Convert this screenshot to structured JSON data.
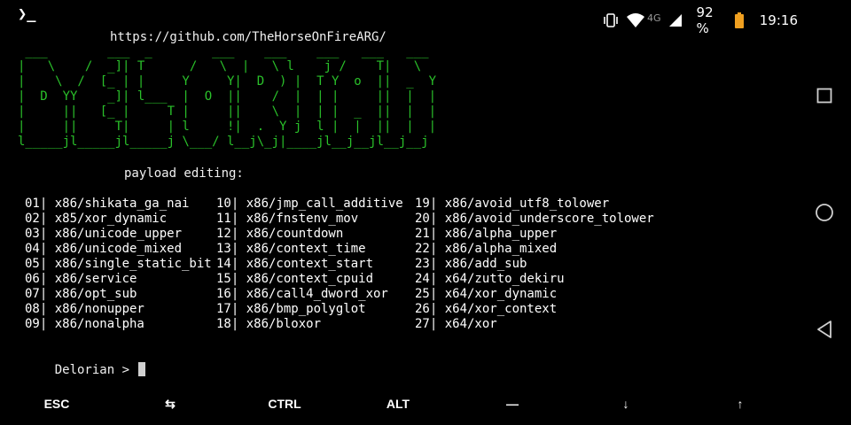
{
  "status": {
    "app_icon": "❯_",
    "network_type": "4G",
    "battery": "92 %",
    "time": "19:16",
    "icons": [
      "vibrate-icon",
      "wifi-icon",
      "signal-icon",
      "battery-icon"
    ],
    "battery_color": "#f0a020"
  },
  "terminal": {
    "url": "https://github.com/TheHorseOnFireARG/",
    "banner": [
      " ___        ___  _        ___    ___    ___   ___   ___",
      "|   \\    /  _]| T      /   \\  |   \\ l    j /    T|   \\",
      "|    \\  /  [_ | |     Y     Y|  D  ) |  T Y  o  ||  _  Y",
      "|  D  YY    _]| l___  |  O  ||    /  |  | |     ||  |  |",
      "|     ||   [_ |     T |     ||    \\  |  | |  _  ||  |  |",
      "|     ||     T|     | l     !|  .  Y j  l |  |  ||  |  |",
      "l_____jl_____jl_____j \\___/ l__j\\_j|____jl__j__jl__j__j"
    ],
    "heading": "payload editing:",
    "columns": [
      [
        "01| x86/shikata_ga_nai",
        "02| x85/xor_dynamic",
        "03| x86/unicode_upper",
        "04| x86/unicode_mixed",
        "05| x86/single_static_bit",
        "06| x86/service",
        "07| x86/opt_sub",
        "08| x86/nonupper",
        "09| x86/nonalpha"
      ],
      [
        "10| x86/jmp_call_additive",
        "11| x86/fnstenv_mov",
        "12| x86/countdown",
        "13| x86/context_time",
        "14| x86/context_start",
        "15| x86/context_cpuid",
        "16| x86/call4_dword_xor",
        "17| x86/bmp_polyglot",
        "18| x86/bloxor"
      ],
      [
        "19| x86/avoid_utf8_tolower",
        "20| x86/avoid_underscore_tolower",
        "21| x86/alpha_upper",
        "22| x86/alpha_mixed",
        "23| x86/add_sub",
        "24| x64/zutto_dekiru",
        "25| x64/xor_dynamic",
        "26| x64/xor_context",
        "27| x64/xor"
      ]
    ],
    "prompt": "Delorian > ",
    "banner_color": "#2ac12a"
  },
  "extra_keys": [
    "ESC",
    "⇆",
    "CTRL",
    "ALT",
    "—",
    "↓",
    "↑"
  ],
  "nav": [
    "recents-square-icon",
    "home-circle-icon",
    "back-triangle-icon"
  ]
}
